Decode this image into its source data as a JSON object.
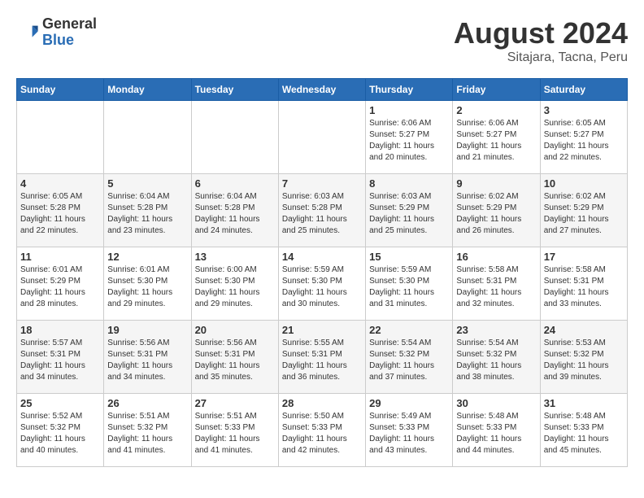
{
  "header": {
    "logo": {
      "general": "General",
      "blue": "Blue"
    },
    "month": "August 2024",
    "location": "Sitajara, Tacna, Peru"
  },
  "weekdays": [
    "Sunday",
    "Monday",
    "Tuesday",
    "Wednesday",
    "Thursday",
    "Friday",
    "Saturday"
  ],
  "weeks": [
    [
      {
        "day": "",
        "sunrise": "",
        "sunset": "",
        "daylight": ""
      },
      {
        "day": "",
        "sunrise": "",
        "sunset": "",
        "daylight": ""
      },
      {
        "day": "",
        "sunrise": "",
        "sunset": "",
        "daylight": ""
      },
      {
        "day": "",
        "sunrise": "",
        "sunset": "",
        "daylight": ""
      },
      {
        "day": "1",
        "sunrise": "Sunrise: 6:06 AM",
        "sunset": "Sunset: 5:27 PM",
        "daylight": "Daylight: 11 hours and 20 minutes."
      },
      {
        "day": "2",
        "sunrise": "Sunrise: 6:06 AM",
        "sunset": "Sunset: 5:27 PM",
        "daylight": "Daylight: 11 hours and 21 minutes."
      },
      {
        "day": "3",
        "sunrise": "Sunrise: 6:05 AM",
        "sunset": "Sunset: 5:27 PM",
        "daylight": "Daylight: 11 hours and 22 minutes."
      }
    ],
    [
      {
        "day": "4",
        "sunrise": "Sunrise: 6:05 AM",
        "sunset": "Sunset: 5:28 PM",
        "daylight": "Daylight: 11 hours and 22 minutes."
      },
      {
        "day": "5",
        "sunrise": "Sunrise: 6:04 AM",
        "sunset": "Sunset: 5:28 PM",
        "daylight": "Daylight: 11 hours and 23 minutes."
      },
      {
        "day": "6",
        "sunrise": "Sunrise: 6:04 AM",
        "sunset": "Sunset: 5:28 PM",
        "daylight": "Daylight: 11 hours and 24 minutes."
      },
      {
        "day": "7",
        "sunrise": "Sunrise: 6:03 AM",
        "sunset": "Sunset: 5:28 PM",
        "daylight": "Daylight: 11 hours and 25 minutes."
      },
      {
        "day": "8",
        "sunrise": "Sunrise: 6:03 AM",
        "sunset": "Sunset: 5:29 PM",
        "daylight": "Daylight: 11 hours and 25 minutes."
      },
      {
        "day": "9",
        "sunrise": "Sunrise: 6:02 AM",
        "sunset": "Sunset: 5:29 PM",
        "daylight": "Daylight: 11 hours and 26 minutes."
      },
      {
        "day": "10",
        "sunrise": "Sunrise: 6:02 AM",
        "sunset": "Sunset: 5:29 PM",
        "daylight": "Daylight: 11 hours and 27 minutes."
      }
    ],
    [
      {
        "day": "11",
        "sunrise": "Sunrise: 6:01 AM",
        "sunset": "Sunset: 5:29 PM",
        "daylight": "Daylight: 11 hours and 28 minutes."
      },
      {
        "day": "12",
        "sunrise": "Sunrise: 6:01 AM",
        "sunset": "Sunset: 5:30 PM",
        "daylight": "Daylight: 11 hours and 29 minutes."
      },
      {
        "day": "13",
        "sunrise": "Sunrise: 6:00 AM",
        "sunset": "Sunset: 5:30 PM",
        "daylight": "Daylight: 11 hours and 29 minutes."
      },
      {
        "day": "14",
        "sunrise": "Sunrise: 5:59 AM",
        "sunset": "Sunset: 5:30 PM",
        "daylight": "Daylight: 11 hours and 30 minutes."
      },
      {
        "day": "15",
        "sunrise": "Sunrise: 5:59 AM",
        "sunset": "Sunset: 5:30 PM",
        "daylight": "Daylight: 11 hours and 31 minutes."
      },
      {
        "day": "16",
        "sunrise": "Sunrise: 5:58 AM",
        "sunset": "Sunset: 5:31 PM",
        "daylight": "Daylight: 11 hours and 32 minutes."
      },
      {
        "day": "17",
        "sunrise": "Sunrise: 5:58 AM",
        "sunset": "Sunset: 5:31 PM",
        "daylight": "Daylight: 11 hours and 33 minutes."
      }
    ],
    [
      {
        "day": "18",
        "sunrise": "Sunrise: 5:57 AM",
        "sunset": "Sunset: 5:31 PM",
        "daylight": "Daylight: 11 hours and 34 minutes."
      },
      {
        "day": "19",
        "sunrise": "Sunrise: 5:56 AM",
        "sunset": "Sunset: 5:31 PM",
        "daylight": "Daylight: 11 hours and 34 minutes."
      },
      {
        "day": "20",
        "sunrise": "Sunrise: 5:56 AM",
        "sunset": "Sunset: 5:31 PM",
        "daylight": "Daylight: 11 hours and 35 minutes."
      },
      {
        "day": "21",
        "sunrise": "Sunrise: 5:55 AM",
        "sunset": "Sunset: 5:31 PM",
        "daylight": "Daylight: 11 hours and 36 minutes."
      },
      {
        "day": "22",
        "sunrise": "Sunrise: 5:54 AM",
        "sunset": "Sunset: 5:32 PM",
        "daylight": "Daylight: 11 hours and 37 minutes."
      },
      {
        "day": "23",
        "sunrise": "Sunrise: 5:54 AM",
        "sunset": "Sunset: 5:32 PM",
        "daylight": "Daylight: 11 hours and 38 minutes."
      },
      {
        "day": "24",
        "sunrise": "Sunrise: 5:53 AM",
        "sunset": "Sunset: 5:32 PM",
        "daylight": "Daylight: 11 hours and 39 minutes."
      }
    ],
    [
      {
        "day": "25",
        "sunrise": "Sunrise: 5:52 AM",
        "sunset": "Sunset: 5:32 PM",
        "daylight": "Daylight: 11 hours and 40 minutes."
      },
      {
        "day": "26",
        "sunrise": "Sunrise: 5:51 AM",
        "sunset": "Sunset: 5:32 PM",
        "daylight": "Daylight: 11 hours and 41 minutes."
      },
      {
        "day": "27",
        "sunrise": "Sunrise: 5:51 AM",
        "sunset": "Sunset: 5:33 PM",
        "daylight": "Daylight: 11 hours and 41 minutes."
      },
      {
        "day": "28",
        "sunrise": "Sunrise: 5:50 AM",
        "sunset": "Sunset: 5:33 PM",
        "daylight": "Daylight: 11 hours and 42 minutes."
      },
      {
        "day": "29",
        "sunrise": "Sunrise: 5:49 AM",
        "sunset": "Sunset: 5:33 PM",
        "daylight": "Daylight: 11 hours and 43 minutes."
      },
      {
        "day": "30",
        "sunrise": "Sunrise: 5:48 AM",
        "sunset": "Sunset: 5:33 PM",
        "daylight": "Daylight: 11 hours and 44 minutes."
      },
      {
        "day": "31",
        "sunrise": "Sunrise: 5:48 AM",
        "sunset": "Sunset: 5:33 PM",
        "daylight": "Daylight: 11 hours and 45 minutes."
      }
    ]
  ]
}
